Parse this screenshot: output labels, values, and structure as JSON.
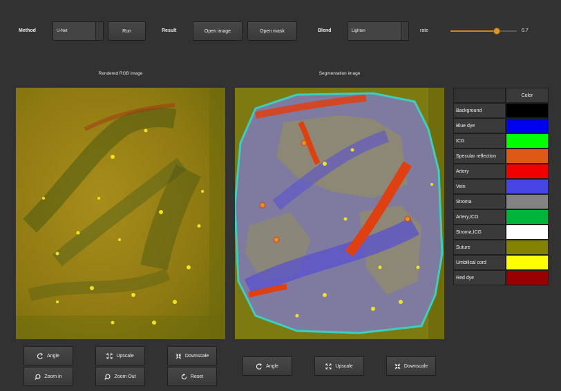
{
  "toolbar": {
    "method_label": "Method",
    "method_value": "U-Net",
    "run_label": "Run",
    "result_label": "Result",
    "open_image_label": "Open image",
    "open_mask_label": "Open mask",
    "blend_label": "Blend",
    "blend_value": "Lighten",
    "rate_label": "rate",
    "rate_value": "0.7",
    "rate_fraction": 0.7
  },
  "left_panel": {
    "caption": "Rendered RGB image",
    "buttons": {
      "angle": "Angle",
      "upscale": "Upscale",
      "downscale": "Downscale",
      "zoom_in": "Zoom in",
      "zoom_out": "Zoom Out",
      "reset": "Reset"
    }
  },
  "right_panel": {
    "caption": "Segmentation image",
    "buttons": {
      "angle": "Angle",
      "upscale": "Upscale",
      "downscale": "Downscale"
    }
  },
  "legend": {
    "color_header": "Color",
    "items": [
      {
        "label": "Background",
        "color": "#000000"
      },
      {
        "label": "Blue dye",
        "color": "#0000f0"
      },
      {
        "label": "ICG",
        "color": "#00ff00"
      },
      {
        "label": "Specular reflection",
        "color": "#dd5a14"
      },
      {
        "label": "Artery",
        "color": "#f00000"
      },
      {
        "label": "Vein",
        "color": "#4646e6"
      },
      {
        "label": "Stroma",
        "color": "#828282"
      },
      {
        "label": "Artery,ICG",
        "color": "#00b43c"
      },
      {
        "label": "Stroma,ICG",
        "color": "#ffffff"
      },
      {
        "label": "Suture",
        "color": "#828200"
      },
      {
        "label": "Umbilical cord",
        "color": "#ffff00"
      },
      {
        "label": "Red dye",
        "color": "#960000"
      }
    ]
  }
}
